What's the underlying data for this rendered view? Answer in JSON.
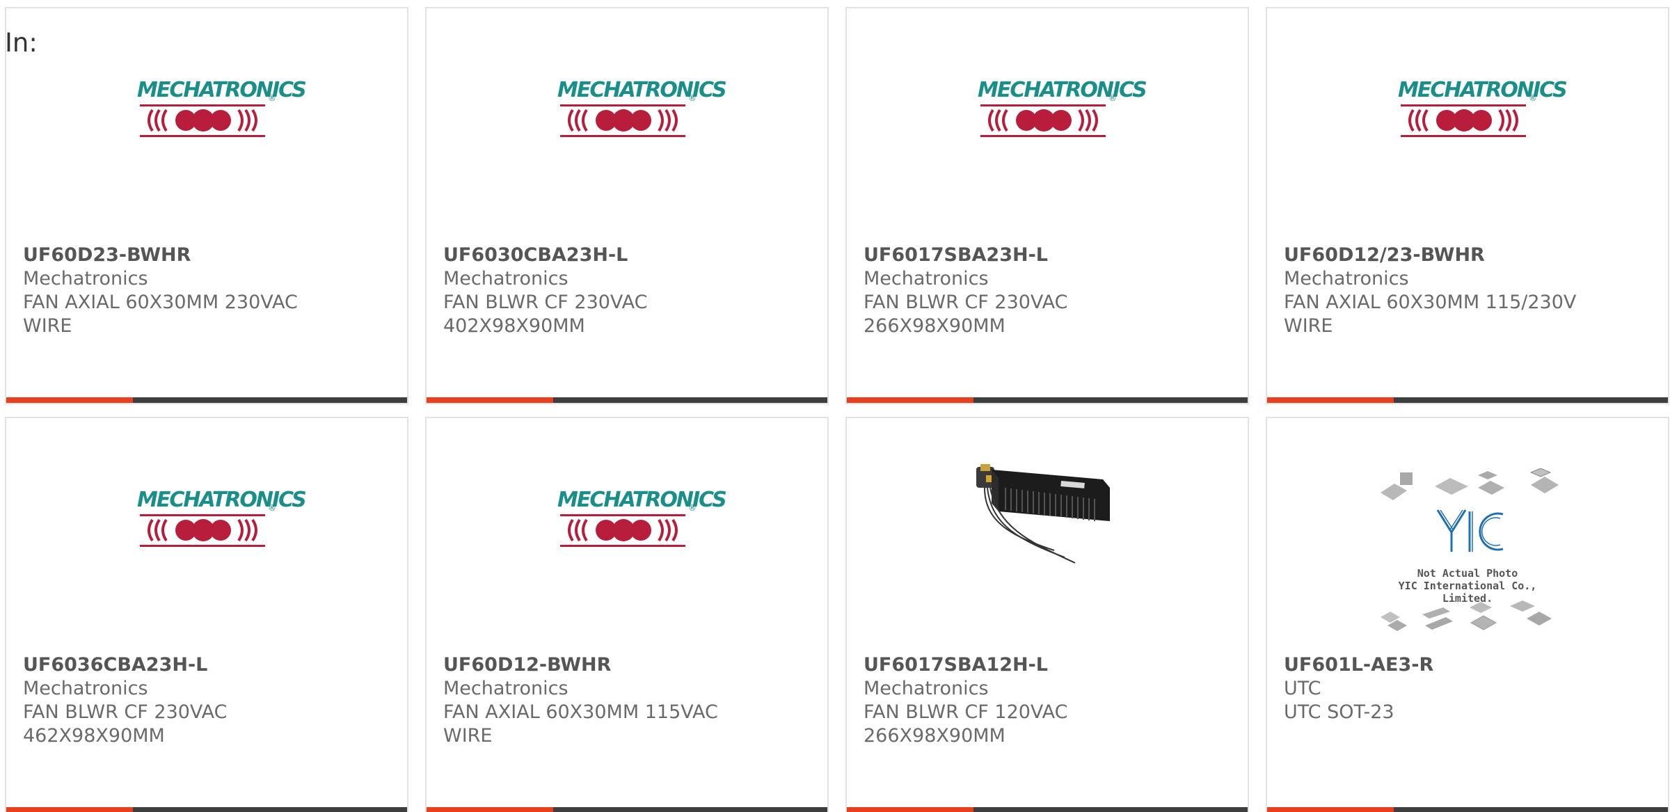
{
  "in_label": "In:",
  "logo_text": "MECHATRONICS",
  "colors": {
    "accent": "#e8401c",
    "bar": "#3e3e3e",
    "logo_teal": "#1a8f8a",
    "logo_red": "#b81e3c"
  },
  "products": [
    {
      "part": "UF60D23-BWHR",
      "manufacturer": "Mechatronics",
      "description": "FAN AXIAL 60X30MM 230VAC\nWIRE",
      "image": "mechatronics-logo"
    },
    {
      "part": "UF6030CBA23H-L",
      "manufacturer": "Mechatronics",
      "description": "FAN BLWR CF 230VAC\n402X98X90MM",
      "image": "mechatronics-logo"
    },
    {
      "part": "UF6017SBA23H-L",
      "manufacturer": "Mechatronics",
      "description": "FAN BLWR CF 230VAC\n266X98X90MM",
      "image": "mechatronics-logo"
    },
    {
      "part": "UF60D12/23-BWHR",
      "manufacturer": "Mechatronics",
      "description": "FAN AXIAL 60X30MM 115/230V\nWIRE",
      "image": "mechatronics-logo"
    },
    {
      "part": "UF6036CBA23H-L",
      "manufacturer": "Mechatronics",
      "description": "FAN BLWR CF 230VAC\n462X98X90MM",
      "image": "mechatronics-logo"
    },
    {
      "part": "UF60D12-BWHR",
      "manufacturer": "Mechatronics",
      "description": "FAN AXIAL 60X30MM 115VAC\nWIRE",
      "image": "mechatronics-logo"
    },
    {
      "part": "UF6017SBA12H-L",
      "manufacturer": "Mechatronics",
      "description": "FAN BLWR CF 120VAC\n266X98X90MM",
      "image": "blower-photo"
    },
    {
      "part": "UF601L-AE3-R",
      "manufacturer": "UTC",
      "description": "UTC SOT-23",
      "image": "yic-placeholder",
      "image_caption_1": "Not Actual Photo",
      "image_caption_2": "YIC International Co., Limited.",
      "image_logo": "YIC"
    }
  ]
}
